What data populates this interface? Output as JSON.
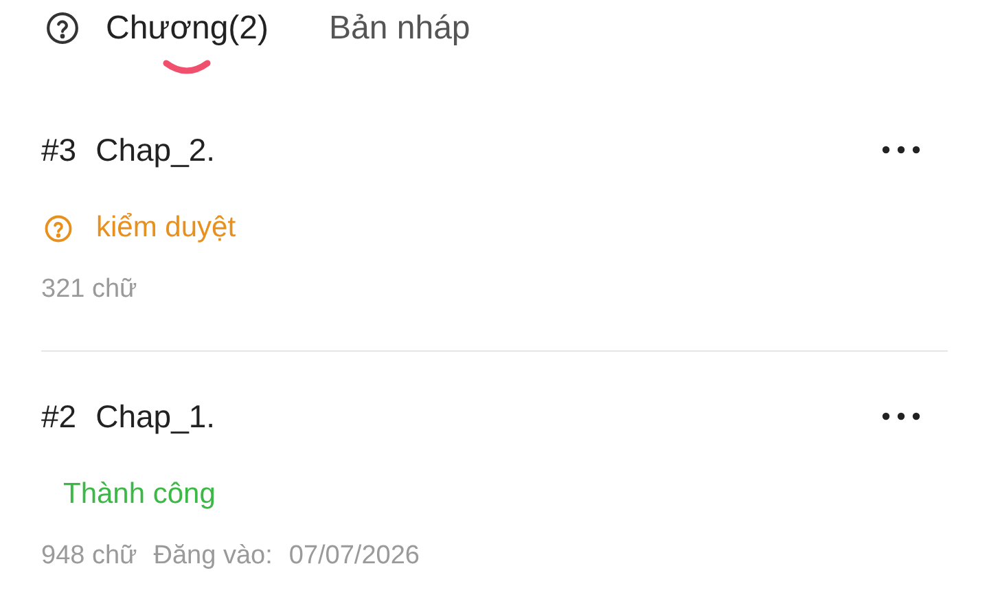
{
  "tabs": [
    {
      "label": "Chương(2)",
      "selected": true
    },
    {
      "label": "Bản nháp",
      "selected": false
    }
  ],
  "chapters": [
    {
      "number": "#3",
      "title": "Chap_2.",
      "status": {
        "kind": "review",
        "label": "kiểm duyệt"
      },
      "meta": [
        "321 chữ"
      ]
    },
    {
      "number": "#2",
      "title": "Chap_1.",
      "status": {
        "kind": "success",
        "label": "Thành công"
      },
      "meta": [
        "948 chữ",
        "Đăng vào:",
        "07/07/2026"
      ]
    }
  ]
}
